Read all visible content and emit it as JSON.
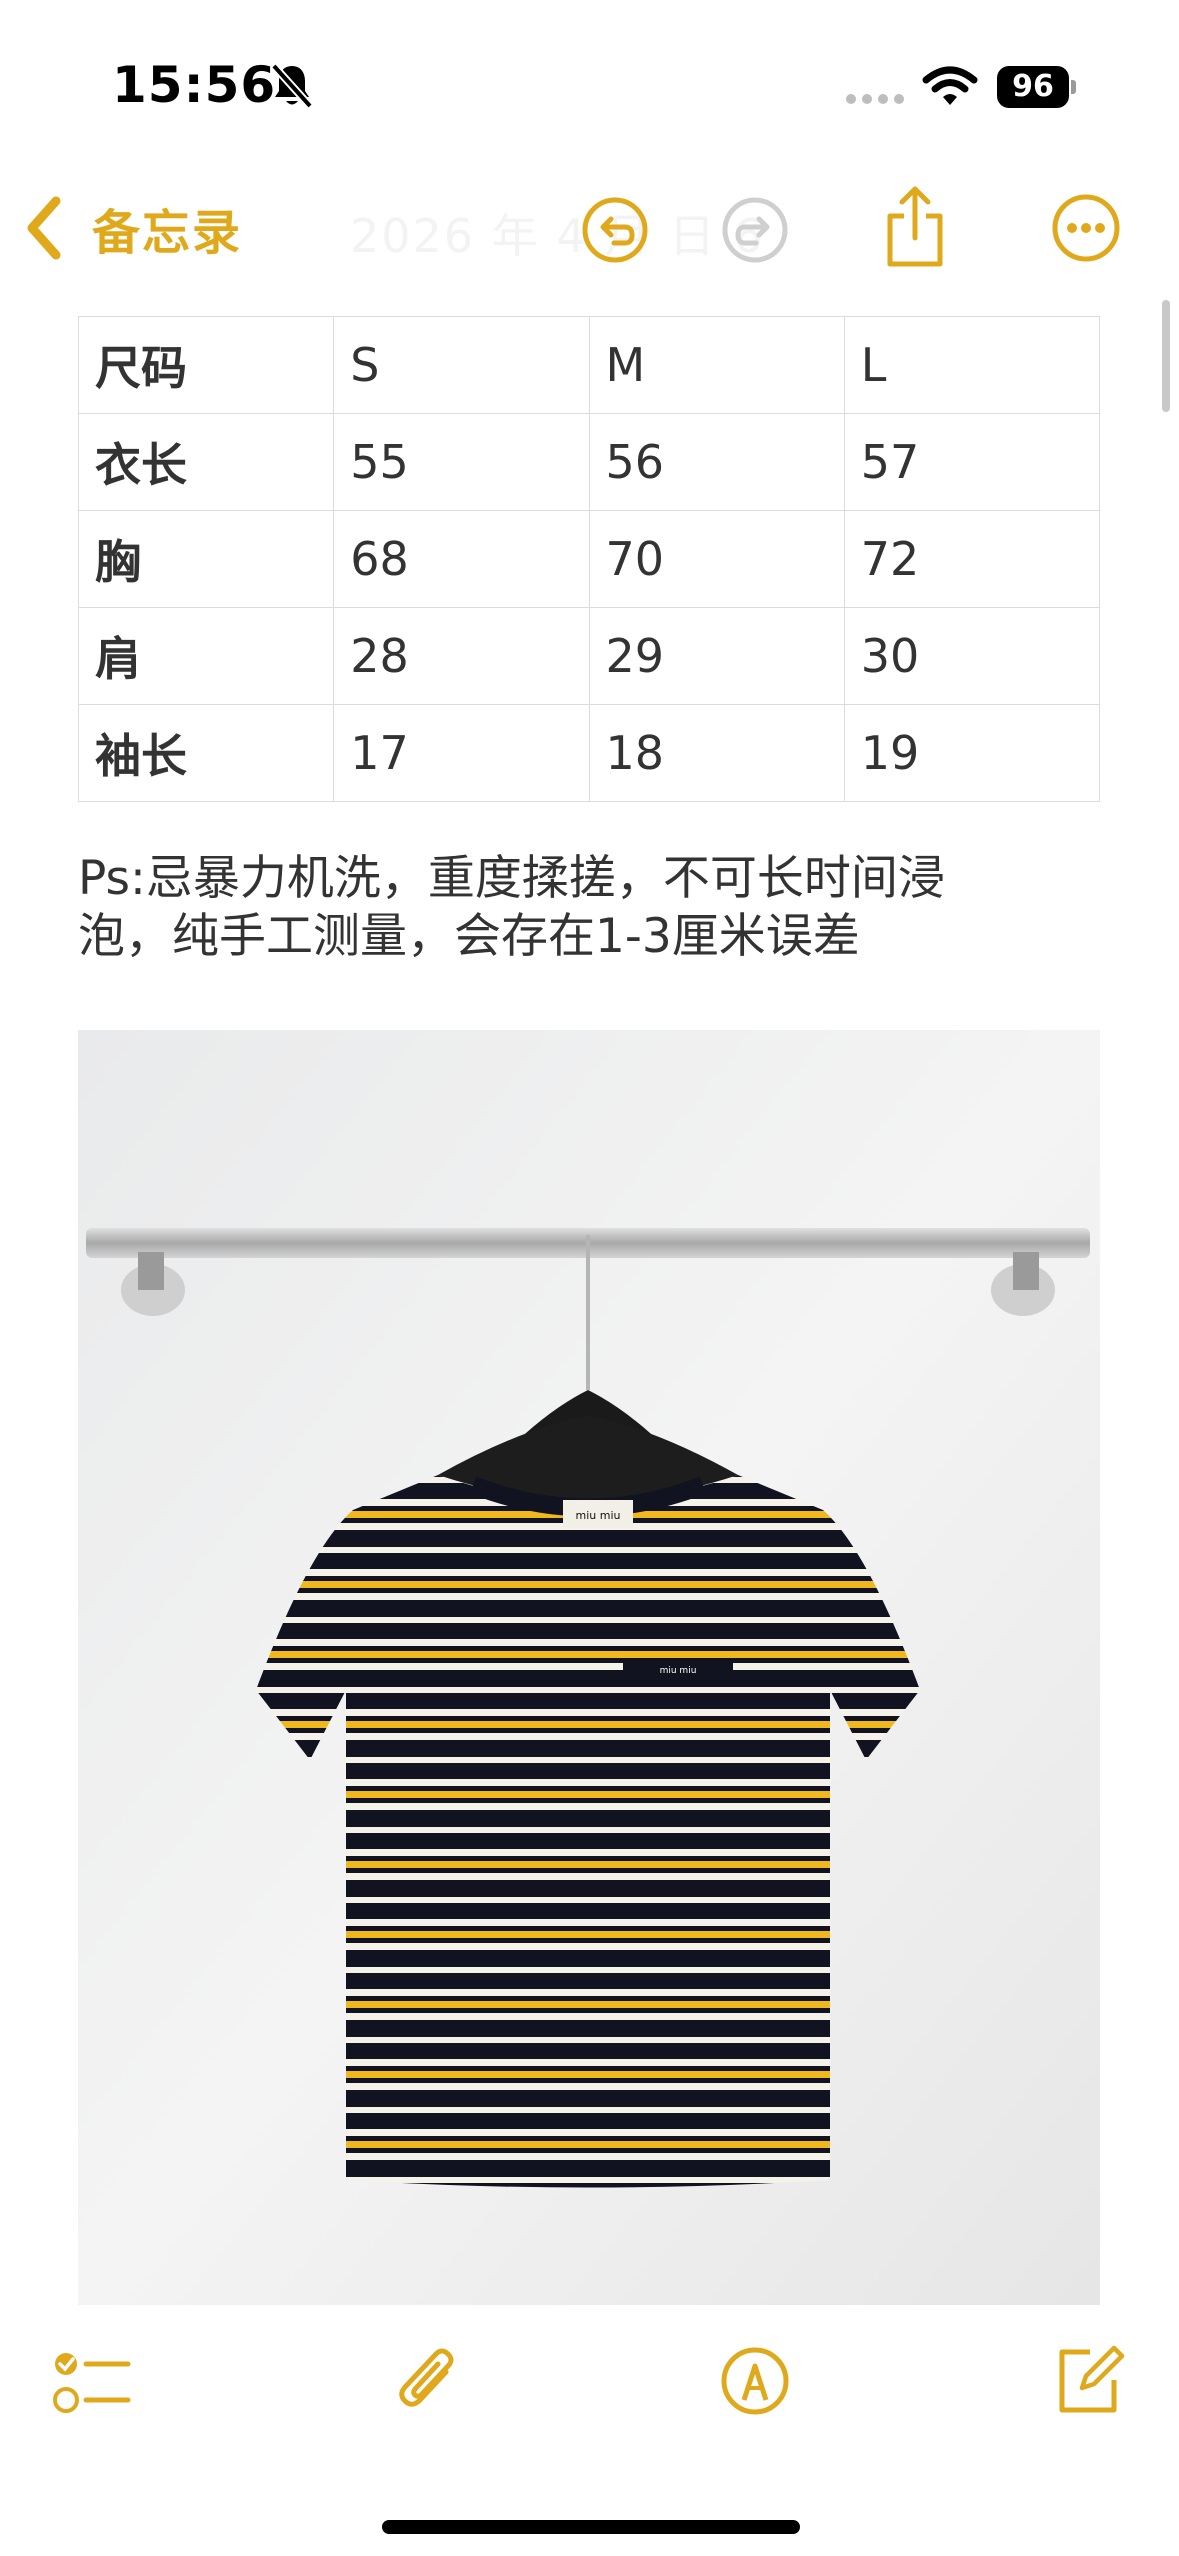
{
  "status_bar": {
    "time": "15:56",
    "battery": "96"
  },
  "nav": {
    "back_label": "备忘录",
    "faint_date": "2026 年 4 月 日   6"
  },
  "table": {
    "header": [
      "尺码",
      "S",
      "M",
      "L"
    ],
    "rows": [
      [
        "衣长",
        "55",
        "56",
        "57"
      ],
      [
        "胸",
        "68",
        "70",
        "72"
      ],
      [
        "肩",
        "28",
        "29",
        "30"
      ],
      [
        "袖长",
        "17",
        "18",
        "19"
      ]
    ]
  },
  "note": {
    "line1": "Ps:忌暴力机洗，重度揉搓，不可长时间浸",
    "line2": "泡，纯手工测量，会存在1-3厘米误差"
  },
  "photo": {
    "label_brand": "miu miu"
  },
  "colors": {
    "accent": "#e0a91c",
    "stripe_black": "#121320",
    "stripe_yellow": "#f0b81c"
  },
  "icons": [
    "bell-slash-icon",
    "cellular-dots-icon",
    "wifi-icon",
    "battery-icon",
    "back-chevron-icon",
    "undo-icon",
    "redo-icon",
    "share-icon",
    "more-icon",
    "checklist-icon",
    "attachment-icon",
    "markup-icon",
    "compose-icon"
  ]
}
